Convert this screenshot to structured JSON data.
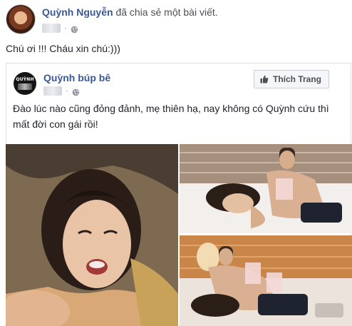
{
  "post": {
    "author_name": "Quỳnh Nguyễn",
    "action_text": "đã chia sẻ một bài viết.",
    "caption": "Chú ơi !!! Cháu xin chú:)))",
    "separator": "·"
  },
  "shared_post": {
    "page_name": "Quỳnh búp bê",
    "page_avatar_text": "QUỲNH",
    "like_page_label": "Thích Trang",
    "separator": "·",
    "text": "Đào lúc nào cũng đỏng đảnh, mẹ thiên hạ, nay không có Quỳnh cứu thì mất đời con gái rồi!"
  },
  "icons": {
    "globe": "globe-icon",
    "like": "thumbs-up-icon"
  },
  "colors": {
    "link_blue": "#385898",
    "text": "#1d2129",
    "muted": "#90949c",
    "border": "#dddfe2"
  }
}
